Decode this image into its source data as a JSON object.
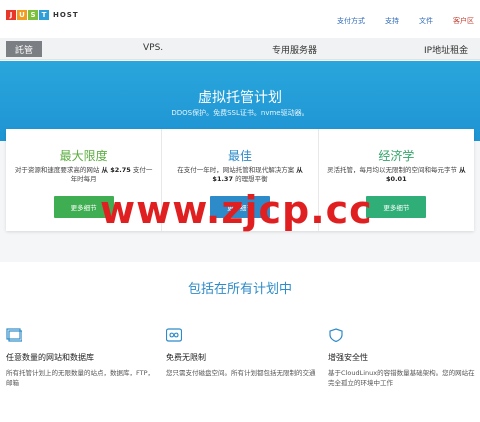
{
  "logo": {
    "letters": [
      "J",
      "U",
      "S",
      "T"
    ],
    "letter_colors": [
      "#e8362a",
      "#f29b1d",
      "#7bbf3a",
      "#2f9fd8"
    ],
    "suffix": "HOST"
  },
  "toplinks": [
    "支付方式",
    "支持",
    "文件",
    "客户区"
  ],
  "nav": {
    "active": "託管",
    "items": [
      "VPS.",
      "专用服务器",
      "IP地址租金"
    ]
  },
  "hero": {
    "title": "虚拟托管计划",
    "subtitle": "DDOS保护。免费SSL证书。nvme驱动器。"
  },
  "plans": [
    {
      "title": "最大限度",
      "title_color": "#5aac3f",
      "desc_1": "对于资源和速度要求高的网站",
      "desc_strong": "从 $2.75",
      "desc_2": "支付一年时每月",
      "button": "更多细节",
      "button_color": "#3fae52"
    },
    {
      "title": "最佳",
      "title_color": "#2e8bc9",
      "desc_1": "在支付一年时，网站托管和现代解决方案",
      "desc_strong": "从 $1.37",
      "desc_2": "的理想平衡",
      "button": "更多细节",
      "button_color": "#2e8bc9"
    },
    {
      "title": "经济学",
      "title_color": "#34a46a",
      "desc_1": "灵活托管，每月均以无限制的空间和每元字节",
      "desc_strong": "从 $0.01",
      "desc_2": "",
      "button": "更多细节",
      "button_color": "#2fae78"
    }
  ],
  "watermark": "www.zjcp.cc",
  "features_section": {
    "title": "包括在所有计划中",
    "items": [
      {
        "icon": "window-icon",
        "title": "任意数量的网站和数据库",
        "desc": "所有托管计划上的无限数量的站点，数据库，FTP，邮箱"
      },
      {
        "icon": "infinity-icon",
        "title": "免费无限制",
        "desc": "您只需支付磁盘空间。所有计划都包括无限制的交通"
      },
      {
        "icon": "shield-icon",
        "title": "增强安全性",
        "desc": "基于CloudLinux的容错数量基础架构。您的网站在完全孤立的环境中工作"
      }
    ]
  },
  "colors": {
    "hero": "#2aa6dc",
    "section_title": "#2e8bc9",
    "watermark": "#e02020"
  }
}
